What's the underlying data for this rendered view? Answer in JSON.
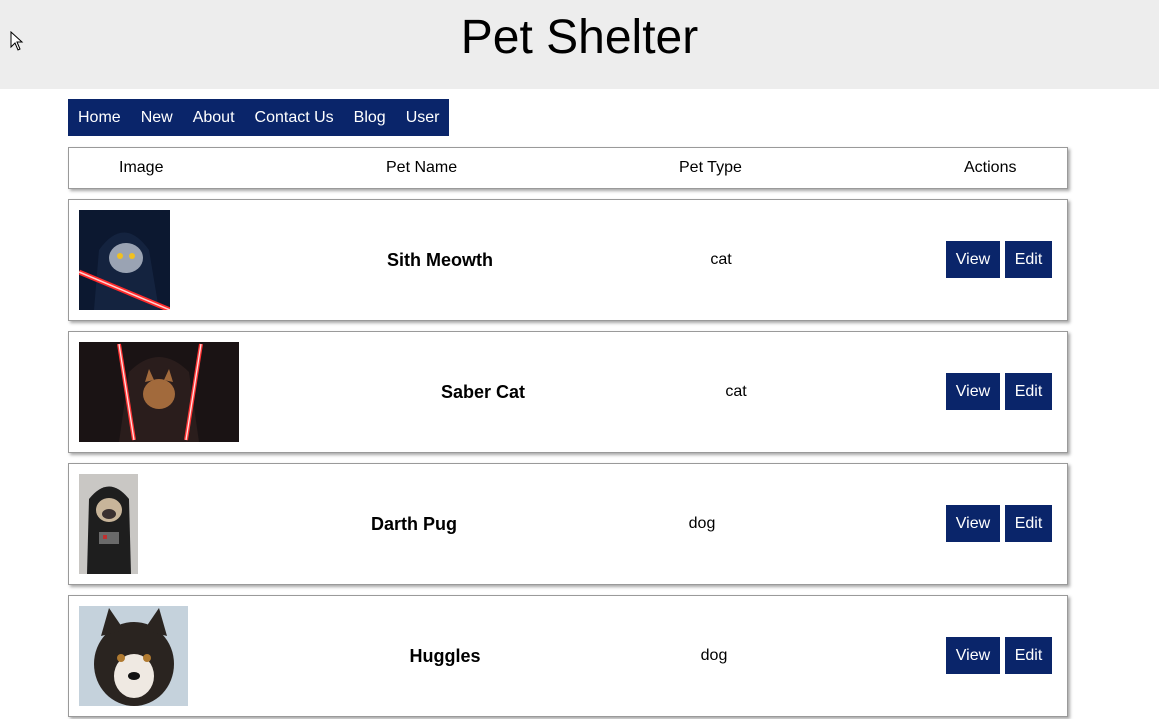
{
  "header": {
    "title": "Pet Shelter"
  },
  "nav": {
    "items": [
      "Home",
      "New",
      "About",
      "Contact Us",
      "Blog",
      "User"
    ]
  },
  "table": {
    "columns": [
      "Image",
      "Pet Name",
      "Pet Type",
      "Actions"
    ]
  },
  "pets": [
    {
      "name": "Sith Meowth",
      "type": "cat",
      "image": "sith-cat-photo",
      "view_label": "View",
      "edit_label": "Edit"
    },
    {
      "name": "Saber Cat",
      "type": "cat",
      "image": "saber-cat-photo",
      "view_label": "View",
      "edit_label": "Edit"
    },
    {
      "name": "Darth Pug",
      "type": "dog",
      "image": "darth-pug-photo",
      "view_label": "View",
      "edit_label": "Edit"
    },
    {
      "name": "Huggles",
      "type": "dog",
      "image": "husky-photo",
      "view_label": "View",
      "edit_label": "Edit"
    }
  ],
  "colors": {
    "accent": "#0a256a",
    "header_bg": "#ededed"
  }
}
